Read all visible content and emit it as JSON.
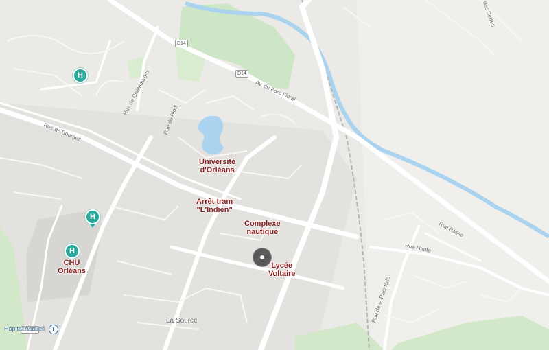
{
  "map": {
    "colors": {
      "land": "#eceae6",
      "urban": "#e2e0dc",
      "park": "#cde6c5",
      "park_light": "#d9eccf",
      "water": "#a9d3ee",
      "road": "#ffffff",
      "poi_text": "#8b1e1e",
      "hospital": "#2aa89b",
      "marker": "#5a5a5a"
    },
    "poi_labels": {
      "universite": [
        "Université",
        "d'Orléans"
      ],
      "arret_tram": [
        "Arrêt tram",
        "\"L'Indien\""
      ],
      "complexe": [
        "Complexe",
        "nautique"
      ],
      "lycee": [
        "Lycée",
        "Voltaire"
      ],
      "chu": [
        "CHU",
        "Orléans"
      ]
    },
    "road_labels": {
      "av_parc_floral": "Av. du Parc Floral",
      "rue_bourges": "Rue de Bourges",
      "rue_chateauroux": "Rue de Châteauroux",
      "rue_blois": "Rue de Blois",
      "rue_haute": "Rue Haute",
      "rue_basse": "Rue Basse",
      "rue_racinerie": "Rue de la Racinerie",
      "rue_serres": "Rue des Serres"
    },
    "shields": {
      "d14_a": "D14",
      "d14_b": "D14",
      "d2020": "D2020"
    },
    "place": "La Source",
    "transit": {
      "label": "Hôpital Accueil",
      "icon": "T"
    },
    "hospital_icon": "H",
    "icons": {
      "hospital": "hospital-icon",
      "tram": "tram-icon",
      "marker": "location-marker-icon"
    }
  }
}
